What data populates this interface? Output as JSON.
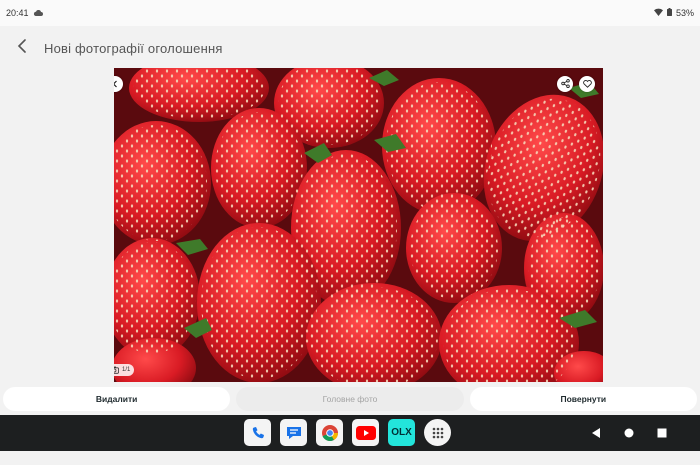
{
  "status_bar": {
    "time": "20:41",
    "battery": "53%",
    "icons": [
      "cloud-icon",
      "wifi-icon",
      "battery-icon"
    ]
  },
  "header": {
    "title": "Нові фотографії оголошення",
    "back_icon": "back-arrow-icon"
  },
  "photo": {
    "subject": "strawberries",
    "counter": "1/1",
    "overlay_icons": [
      "chevron-left-icon",
      "share-icon",
      "heart-icon",
      "camera-icon"
    ]
  },
  "actions": {
    "delete_label": "Видалити",
    "main_photo_label": "Головне фото",
    "rotate_label": "Повернути"
  },
  "taskbar": {
    "apps": [
      "phone-app-icon",
      "messages-app-icon",
      "chrome-app-icon",
      "youtube-app-icon",
      "olx-app-icon",
      "app-drawer-icon"
    ],
    "olx_label": "OLX",
    "nav": [
      "back-nav-icon",
      "home-nav-icon",
      "recents-nav-icon"
    ]
  },
  "colors": {
    "background": "#f2f2f2",
    "taskbar": "#1d1f20",
    "strawberry": "#d91b24",
    "olx": "#23e5db",
    "youtube": "#ff0000"
  }
}
